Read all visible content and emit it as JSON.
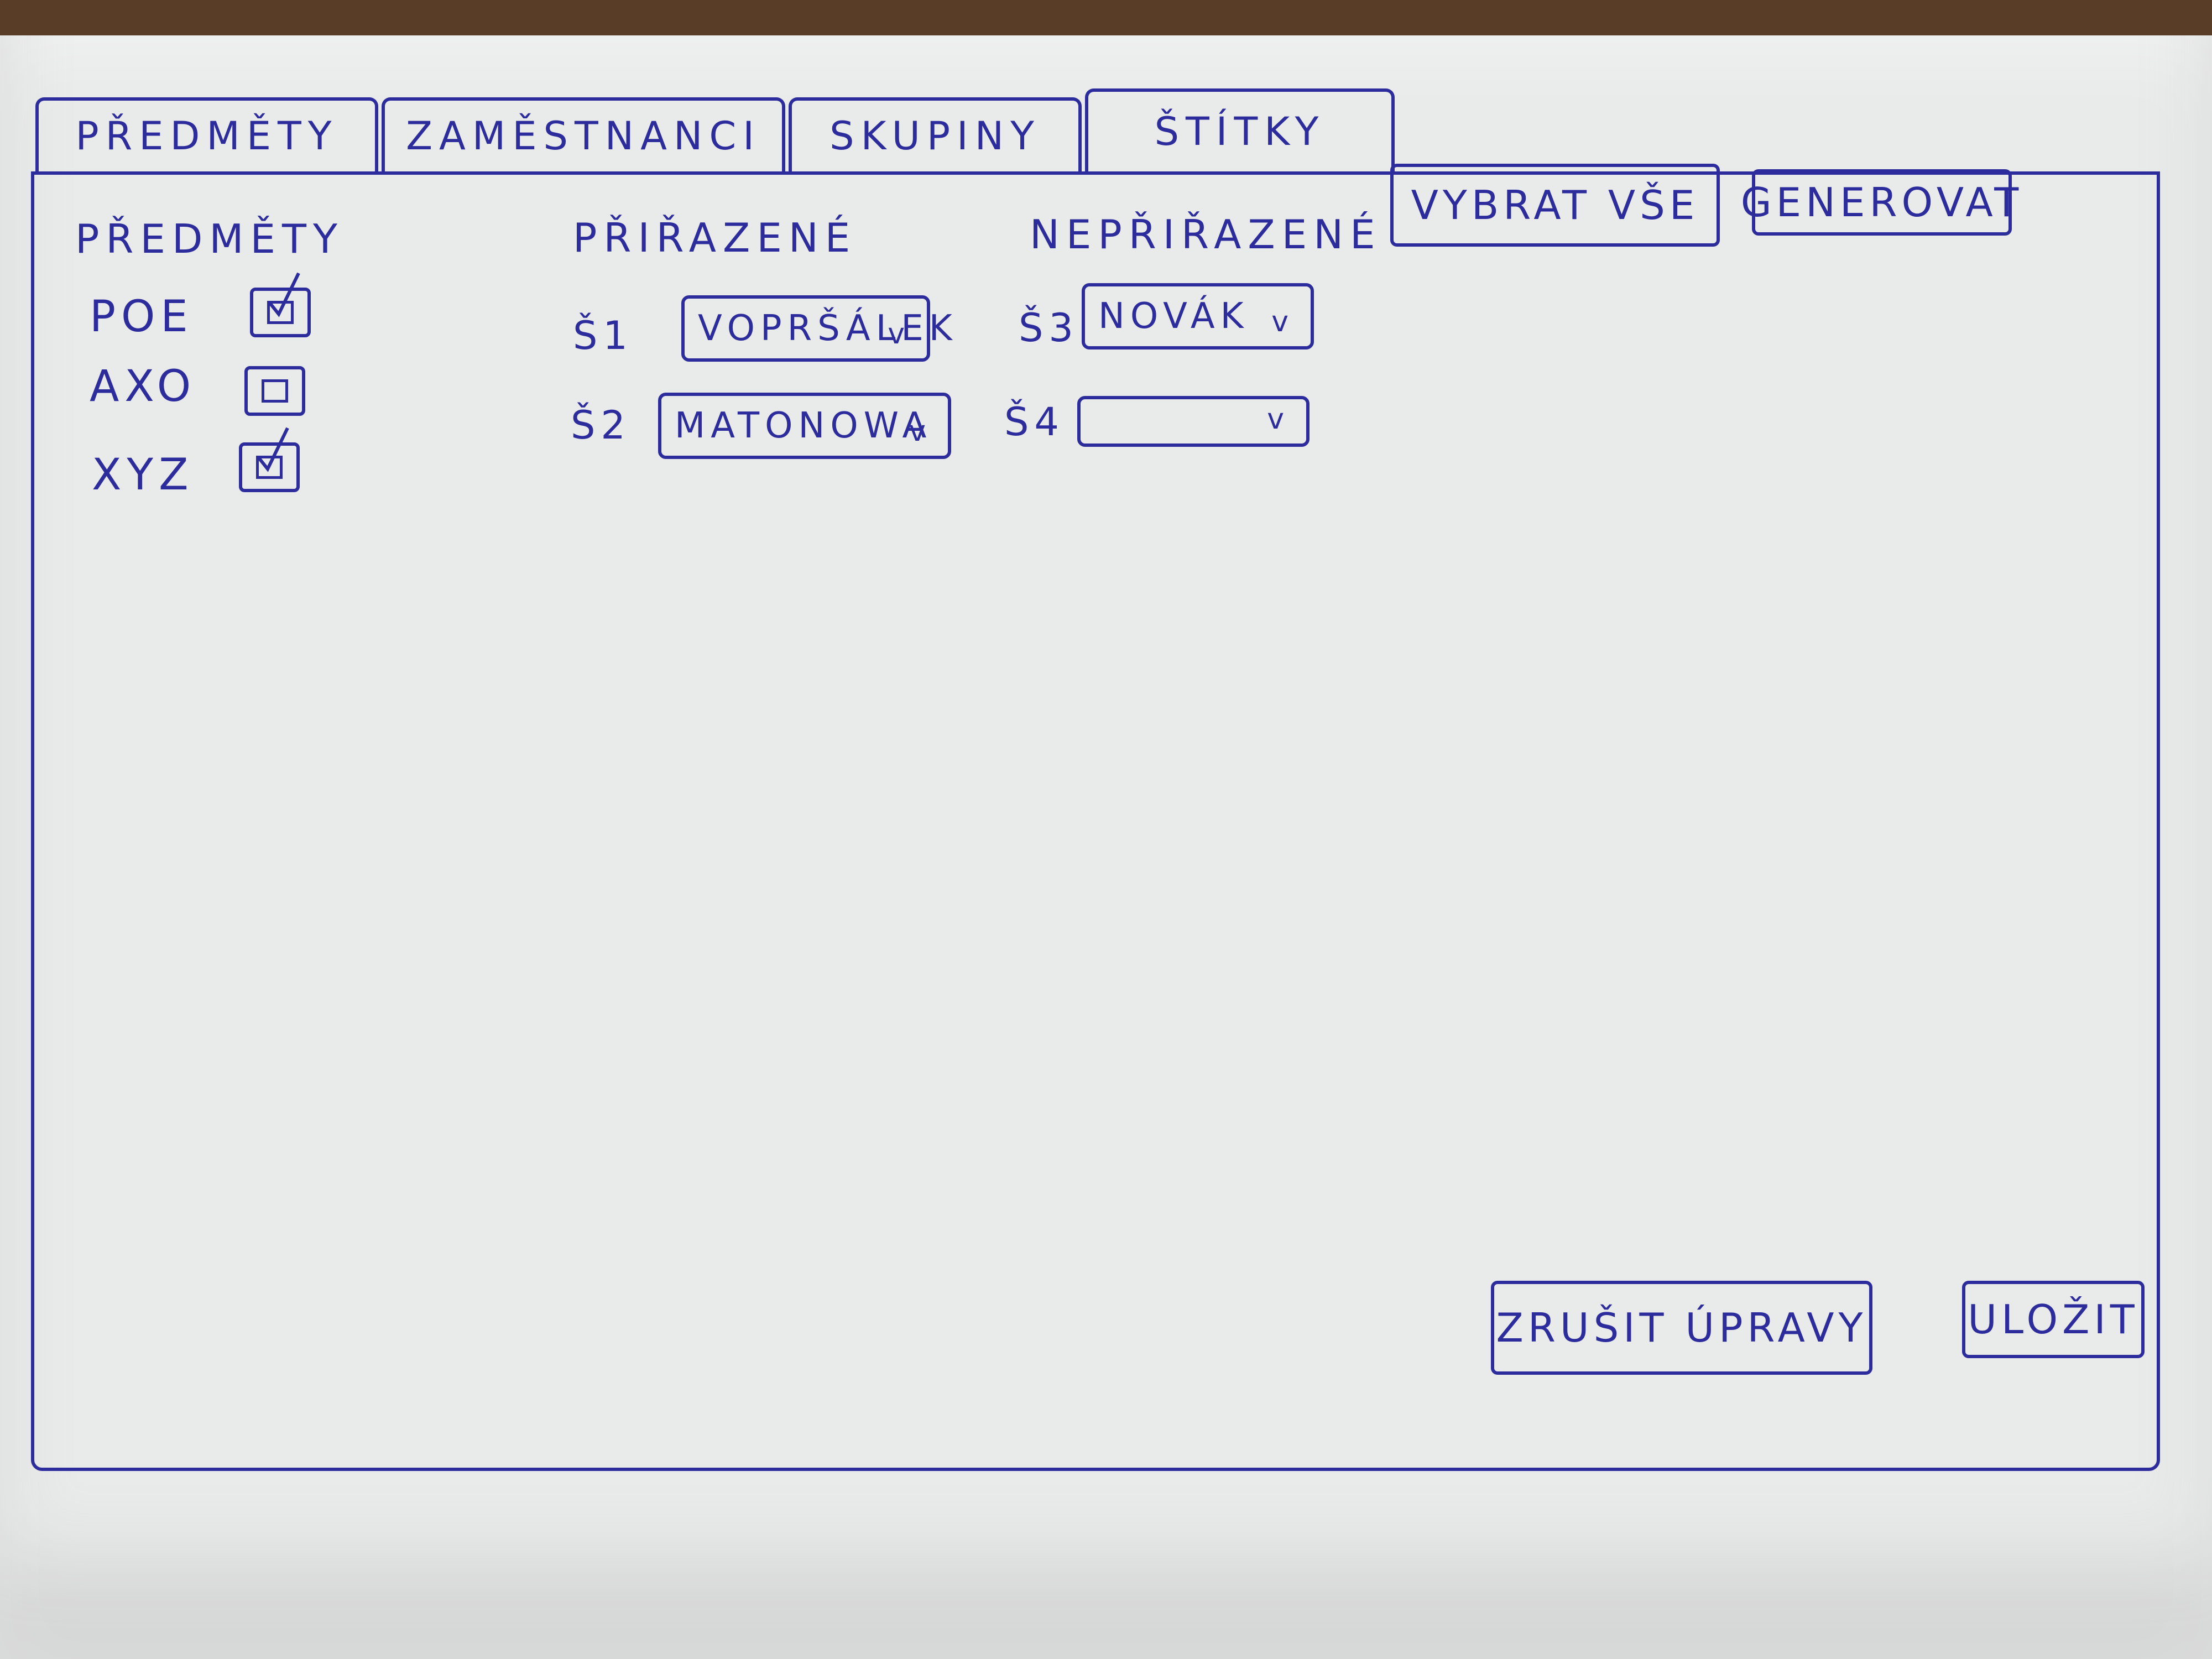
{
  "tabs": [
    {
      "label": "PŘEDMĚTY"
    },
    {
      "label": "ZAMĚSTNANCI"
    },
    {
      "label": "SKUPINY"
    },
    {
      "label": "ŠTÍTKY"
    }
  ],
  "subjects": {
    "heading": "PŘEDMĚTY",
    "items": [
      {
        "label": "POE",
        "checked": true
      },
      {
        "label": "AXO",
        "checked": false
      },
      {
        "label": "XYZ",
        "checked": true
      }
    ]
  },
  "assigned": {
    "heading": "PŘIŘAZENÉ",
    "rows": [
      {
        "label": "Š1",
        "value": "VOPRŠÁLEK",
        "caret": "v"
      },
      {
        "label": "Š2",
        "value": "MATONOWA",
        "caret": "v"
      }
    ]
  },
  "unassigned": {
    "heading": "NEPŘIŘAZENÉ",
    "rows": [
      {
        "label": "Š3",
        "value": "NOVÁK",
        "caret": "v"
      },
      {
        "label": "Š4",
        "value": "",
        "caret": "v"
      }
    ]
  },
  "actions": {
    "select_all": "VYBRAT VŠE",
    "generate": "GENEROVAT",
    "cancel": "ZRUŠIT ÚPRAVY",
    "save": "ULOŽIT"
  }
}
